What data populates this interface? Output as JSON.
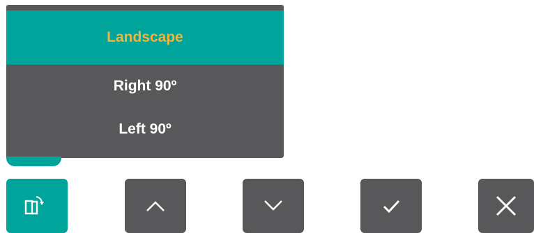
{
  "menu": {
    "items": [
      {
        "label": "Landscape",
        "selected": true
      },
      {
        "label": "Right 90º",
        "selected": false
      },
      {
        "label": "Left 90º",
        "selected": false
      }
    ]
  },
  "buttons": [
    {
      "icon": "rotate-screen-icon",
      "active": true
    },
    {
      "icon": "chevron-up-icon",
      "active": false
    },
    {
      "icon": "chevron-down-icon",
      "active": false
    },
    {
      "icon": "checkmark-icon",
      "active": false
    },
    {
      "icon": "close-icon",
      "active": false
    }
  ],
  "colors": {
    "accent": "#00a49a",
    "panel": "#58585a",
    "selected_text": "#f0b43c",
    "text": "#ffffff"
  }
}
